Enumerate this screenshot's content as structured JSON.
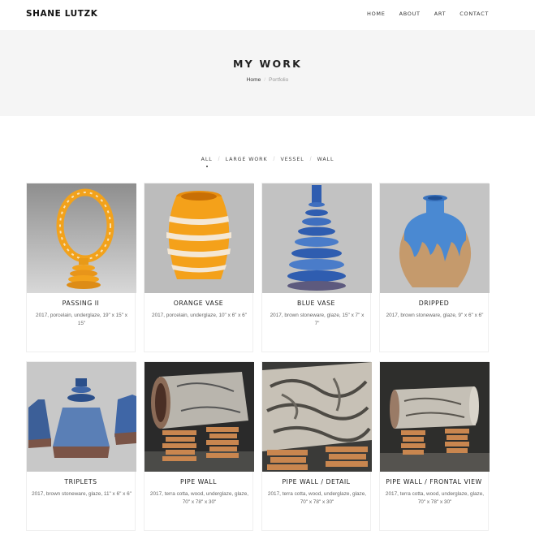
{
  "brand": "SHANE LUTZK",
  "nav": [
    "HOME",
    "ABOUT",
    "ART",
    "CONTACT"
  ],
  "page_title": "MY WORK",
  "breadcrumb": {
    "home": "Home",
    "current": "Portfolio"
  },
  "filters": [
    "ALL",
    "LARGE WORK",
    "VESSEL",
    "WALL"
  ],
  "active_filter": "ALL",
  "works": [
    {
      "title": "PASSING II",
      "desc": "2017, porcelain, underglaze, 19\" x 15\" x 15\""
    },
    {
      "title": "ORANGE VASE",
      "desc": "2017, porcelain, underglaze, 10\" x 6\" x 6\""
    },
    {
      "title": "BLUE VASE",
      "desc": "2017, brown stoneware, glaze, 15\" x 7\" x 7\""
    },
    {
      "title": "DRIPPED",
      "desc": "2017, brown stoneware, glaze, 9\" x 6\" x 6\""
    },
    {
      "title": "TRIPLETS",
      "desc": "2017, brown stoneware, glaze, 11\" x 6\" x 6\""
    },
    {
      "title": "PIPE WALL",
      "desc": "2017, terra cotta, wood, underglaze, glaze, 70\" x 78\" x 30\""
    },
    {
      "title": "PIPE WALL / DETAIL",
      "desc": "2017, terra cotta, wood, underglaze, glaze, 70\" x 78\" x 30\""
    },
    {
      "title": "PIPE WALL / FRONTAL VIEW",
      "desc": "2017, terra cotta, wood, underglaze, glaze, 70\" x 78\" x 30\""
    }
  ],
  "colors": {
    "accent_orange": "#f2a21c",
    "glaze_blue": "#3f6fbf",
    "hero_bg": "#f5f5f5"
  }
}
